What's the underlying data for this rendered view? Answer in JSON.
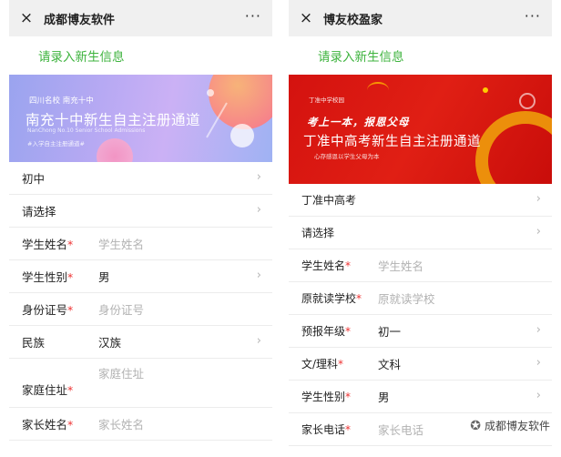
{
  "left": {
    "window_title": "成都博友软件",
    "close_icon": "×",
    "more_icon": "···",
    "prompt": "请录入新生信息",
    "banner": {
      "small_line": "四川名校 南充十中",
      "title": "南充十中新生自主注册通道",
      "sub_line": "NanChong No.10 Senior School Admissions",
      "tag_line": "#入学自主注册通道#"
    },
    "rows": [
      {
        "label": "初中",
        "required": "",
        "value": "",
        "placeholder": "",
        "chevron": "›"
      },
      {
        "label": "请选择",
        "required": "",
        "value": "",
        "placeholder": "",
        "chevron": "›"
      },
      {
        "label": "学生姓名",
        "required": "*",
        "value": "",
        "placeholder": "学生姓名",
        "chevron": ""
      },
      {
        "label": "学生性别",
        "required": "*",
        "value": "男",
        "placeholder": "",
        "chevron": "›"
      },
      {
        "label": "身份证号",
        "required": "*",
        "value": "",
        "placeholder": "身份证号",
        "chevron": ""
      },
      {
        "label": "民族",
        "required": "",
        "value": "汉族",
        "placeholder": "",
        "chevron": "›"
      },
      {
        "label": "家庭住址",
        "required": "*",
        "value": "",
        "placeholder": "家庭住址",
        "chevron": ""
      },
      {
        "label": "家长姓名",
        "required": "*",
        "value": "",
        "placeholder": "家长姓名",
        "chevron": ""
      }
    ]
  },
  "right": {
    "window_title": "博友校盈家",
    "close_icon": "×",
    "more_icon": "···",
    "prompt": "请录入新生信息",
    "banner": {
      "logo_line": "丁准中学校园",
      "slogan": "考上一本，报恩父母",
      "title": "丁准中高考新生自主注册通道",
      "sub_line": "心存感恩以学生父母为本"
    },
    "rows": [
      {
        "label": "丁准中高考",
        "required": "",
        "value": "",
        "placeholder": "",
        "chevron": "›"
      },
      {
        "label": "请选择",
        "required": "",
        "value": "",
        "placeholder": "",
        "chevron": "›"
      },
      {
        "label": "学生姓名",
        "required": "*",
        "value": "",
        "placeholder": "学生姓名",
        "chevron": ""
      },
      {
        "label": "原就读学校",
        "required": "*",
        "value": "",
        "placeholder": "原就读学校",
        "chevron": ""
      },
      {
        "label": "预报年级",
        "required": "*",
        "value": "初一",
        "placeholder": "",
        "chevron": "›"
      },
      {
        "label": "文/理科",
        "required": "*",
        "value": "文科",
        "placeholder": "",
        "chevron": "›"
      },
      {
        "label": "学生性别",
        "required": "*",
        "value": "男",
        "placeholder": "",
        "chevron": "›"
      },
      {
        "label": "家长电话",
        "required": "*",
        "value": "",
        "placeholder": "家长电话",
        "chevron": ""
      }
    ]
  },
  "watermark": {
    "icon": "wechat-icon",
    "text": "成都博友软件"
  },
  "colors": {
    "prompt_green": "#3db33d",
    "required_red": "#ee3333",
    "titlebar_bg": "#f0f0f0"
  }
}
